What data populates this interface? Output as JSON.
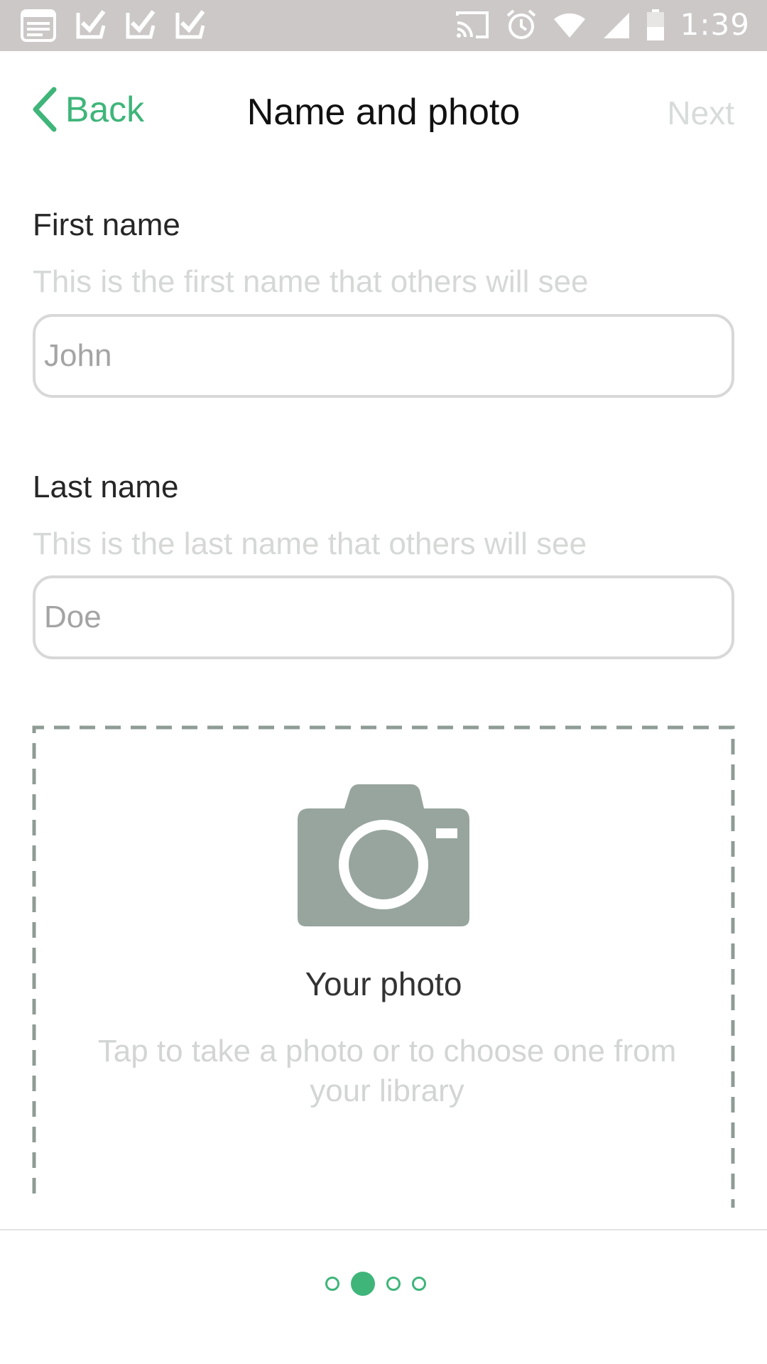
{
  "status_bar": {
    "time": "1:39",
    "left_icons": [
      "notes-icon",
      "check-icon",
      "check-icon",
      "check-icon"
    ],
    "right_icons": [
      "cast-icon",
      "alarm-icon",
      "wifi-icon",
      "signal-icon",
      "battery-icon"
    ]
  },
  "nav": {
    "back_label": "Back",
    "title": "Name and photo",
    "next_label": "Next"
  },
  "form": {
    "first_name": {
      "label": "First name",
      "hint": "This is the first name that others will see",
      "placeholder": "John"
    },
    "last_name": {
      "label": "Last name",
      "hint": "This is the last name that others will see",
      "placeholder": "Doe"
    }
  },
  "photo": {
    "title": "Your photo",
    "description": "Tap to take a photo or to choose one from your library",
    "icon": "camera-icon"
  },
  "pager": {
    "total": 4,
    "current": 2
  },
  "colors": {
    "accent": "#3fb57a",
    "camera": "#97a59e",
    "status_bar": "#cbc8c7"
  }
}
